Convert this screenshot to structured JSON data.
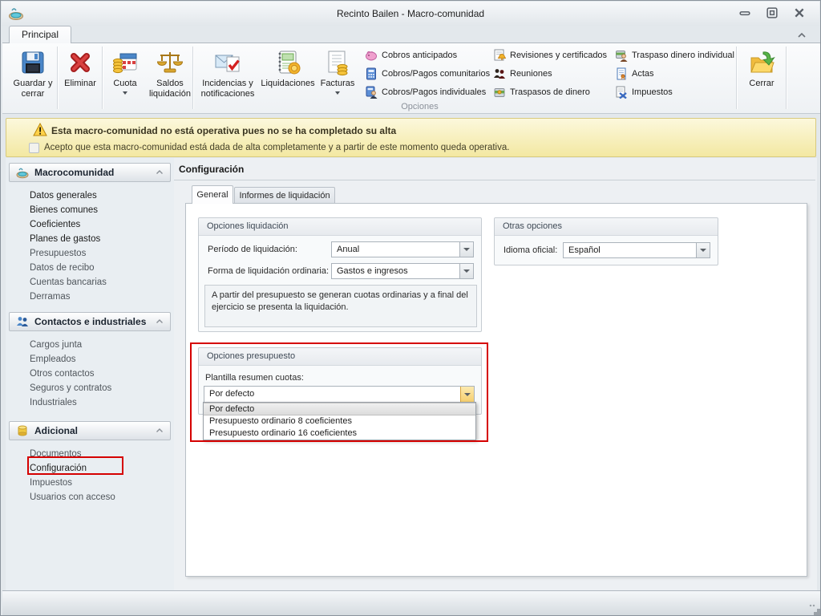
{
  "window": {
    "title": "Recinto Bailen - Macro-comunidad"
  },
  "ribbon": {
    "tab_label": "Principal",
    "group_label": "Opciones",
    "large_buttons": {
      "save": "Guardar y cerrar",
      "delete": "Eliminar",
      "cuota": "Cuota",
      "saldos": "Saldos liquidación",
      "incidencias": "Incidencias y notificaciones",
      "liquidaciones": "Liquidaciones",
      "facturas": "Facturas"
    },
    "small_buttons": {
      "cobros_anticipados": "Cobros anticipados",
      "cobros_pagos_comunitarios": "Cobros/Pagos comunitarios",
      "cobros_pagos_individuales": "Cobros/Pagos individuales",
      "revisiones_certificados": "Revisiones y certificados",
      "reuniones": "Reuniones",
      "traspasos_dinero": "Traspasos de dinero",
      "traspaso_dinero_individual": "Traspaso dinero individual",
      "actas": "Actas",
      "impuestos": "Impuestos"
    },
    "close_button": "Cerrar"
  },
  "warning": {
    "title": "Esta macro-comunidad no está operativa pues no se ha completado su alta",
    "checkbox_label": "Acepto que esta macro-comunidad está dada de alta completamente y a partir de este momento queda operativa."
  },
  "sidebar": {
    "sections": [
      {
        "title": "Macrocomunidad",
        "items": [
          "Datos generales",
          "Bienes comunes",
          "Coeficientes",
          "Planes de gastos",
          "Presupuestos",
          "Datos de recibo",
          "Cuentas bancarias",
          "Derramas"
        ]
      },
      {
        "title": "Contactos e industriales",
        "items": [
          "Cargos junta",
          "Empleados",
          "Otros contactos",
          "Seguros y contratos",
          "Industriales"
        ]
      },
      {
        "title": "Adicional",
        "items": [
          "Documentos",
          "Configuración",
          "Impuestos",
          "Usuarios con acceso"
        ]
      }
    ]
  },
  "main": {
    "title": "Configuración",
    "tabs": [
      "General",
      "Informes de liquidación"
    ],
    "opciones_liquidacion": {
      "title": "Opciones liquidación",
      "periodo_label": "Período de liquidación:",
      "periodo_value": "Anual",
      "forma_label": "Forma de liquidación ordinaria:",
      "forma_value": "Gastos e ingresos",
      "info_text": "A partir del presupuesto se generan cuotas ordinarias y a final del ejercicio se presenta la liquidación."
    },
    "otras_opciones": {
      "title": "Otras opciones",
      "idioma_label": "Idioma oficial:",
      "idioma_value": "Español"
    },
    "opciones_presupuesto": {
      "title": "Opciones presupuesto",
      "plantilla_label": "Plantilla resumen cuotas:",
      "plantilla_value": "Por defecto",
      "options": [
        "Por defecto",
        "Presupuesto ordinario 8 coeficientes",
        "Presupuesto ordinario 16 coeficientes"
      ],
      "selected_option": "Por defecto"
    }
  },
  "colors": {
    "warning_bg": "#F3E8A2",
    "warning_border": "#D8CA7E",
    "highlight_red": "#D50000",
    "dropdown_active_btn": "#F6CF6E",
    "sidebar_bg": "#E9EEF2"
  }
}
